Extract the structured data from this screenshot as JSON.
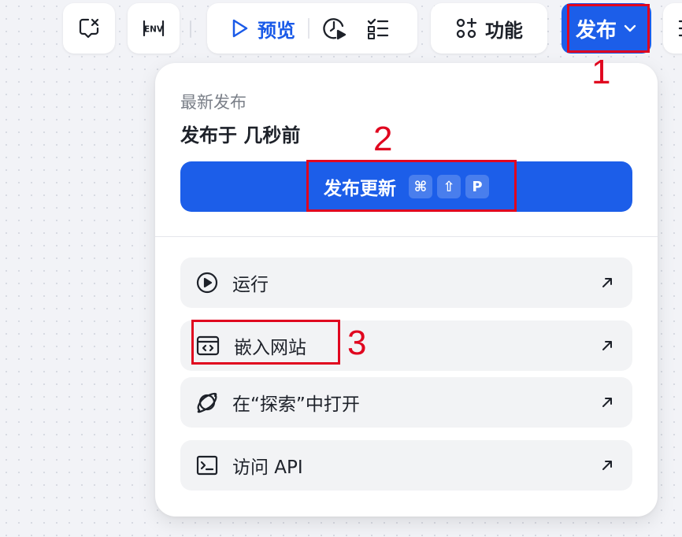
{
  "toolbar": {
    "variable_button_icon": "chat-variable-icon",
    "env_button_label": "ENV",
    "preview_label": "预览",
    "debug_icon": "clock-play-icon",
    "checklist_icon": "checklist-icon",
    "features_label": "功能",
    "features_icon": "features-grid-icon",
    "publish_label": "发布"
  },
  "publish_menu": {
    "section_label": "最新发布",
    "published_at": "发布于 几秒前",
    "update_button_label": "发布更新",
    "shortcut_keys": [
      "⌘",
      "⇧",
      "P"
    ],
    "items": [
      {
        "label": "运行",
        "icon": "play-circle-icon"
      },
      {
        "label": "嵌入网站",
        "icon": "embed-code-icon"
      },
      {
        "label": "在“探索”中打开",
        "icon": "planet-icon"
      },
      {
        "label": "访问 API",
        "icon": "terminal-icon"
      }
    ]
  },
  "annotations": {
    "markers": [
      "1",
      "2",
      "3"
    ],
    "color": "#e0061f"
  },
  "colors": {
    "primary": "#1c5ee9",
    "menu_item_bg": "#f2f3f5",
    "canvas_bg": "#f2f3f7"
  }
}
